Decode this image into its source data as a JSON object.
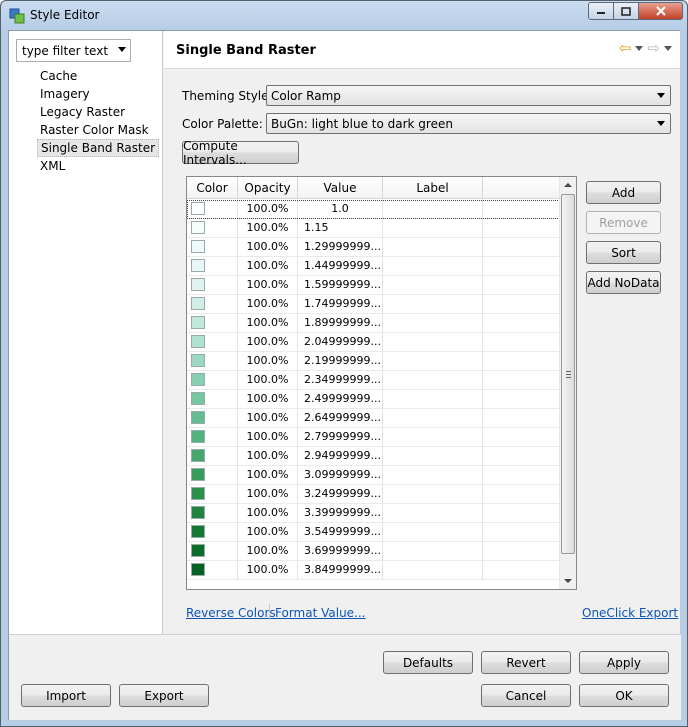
{
  "window": {
    "title": "Style Editor"
  },
  "filter": {
    "text": "type filter text he"
  },
  "tree": {
    "items": [
      "Cache",
      "Imagery",
      "Legacy Raster",
      "Raster Color Mask",
      "Single Band Raster",
      "XML"
    ],
    "selected": "Single Band Raster"
  },
  "page": {
    "title": "Single Band Raster"
  },
  "form": {
    "theming_label": "Theming Style:",
    "theming_value": "Color Ramp",
    "palette_label": "Color Palette:",
    "palette_value": "BuGn: light blue to dark green",
    "compute_label": "Compute Intervals..."
  },
  "table": {
    "headers": {
      "color": "Color",
      "opacity": "Opacity",
      "value": "Value",
      "label": "Label"
    },
    "rows": [
      {
        "color": "#ffffff",
        "opacity": "100.0%",
        "value": "1.0",
        "label": ""
      },
      {
        "color": "#f7fcfd",
        "opacity": "100.0%",
        "value": "1.15",
        "label": ""
      },
      {
        "color": "#f0f9fa",
        "opacity": "100.0%",
        "value": "1.29999999...",
        "label": ""
      },
      {
        "color": "#e8f6f7",
        "opacity": "100.0%",
        "value": "1.44999999...",
        "label": ""
      },
      {
        "color": "#e0f3f0",
        "opacity": "100.0%",
        "value": "1.59999999...",
        "label": ""
      },
      {
        "color": "#d2eee6",
        "opacity": "100.0%",
        "value": "1.74999999...",
        "label": ""
      },
      {
        "color": "#c2e8db",
        "opacity": "100.0%",
        "value": "1.89999999...",
        "label": ""
      },
      {
        "color": "#b0e1ce",
        "opacity": "100.0%",
        "value": "2.04999999...",
        "label": ""
      },
      {
        "color": "#9dd8c0",
        "opacity": "100.0%",
        "value": "2.19999999...",
        "label": ""
      },
      {
        "color": "#89cfb1",
        "opacity": "100.0%",
        "value": "2.34999999...",
        "label": ""
      },
      {
        "color": "#76c6a1",
        "opacity": "100.0%",
        "value": "2.49999999...",
        "label": ""
      },
      {
        "color": "#64bc91",
        "opacity": "100.0%",
        "value": "2.64999999...",
        "label": ""
      },
      {
        "color": "#54b27f",
        "opacity": "100.0%",
        "value": "2.79999999...",
        "label": ""
      },
      {
        "color": "#45a76d",
        "opacity": "100.0%",
        "value": "2.94999999...",
        "label": ""
      },
      {
        "color": "#389c5c",
        "opacity": "100.0%",
        "value": "3.09999999...",
        "label": ""
      },
      {
        "color": "#2b904c",
        "opacity": "100.0%",
        "value": "3.24999999...",
        "label": ""
      },
      {
        "color": "#1f843f",
        "opacity": "100.0%",
        "value": "3.39999999...",
        "label": ""
      },
      {
        "color": "#147833",
        "opacity": "100.0%",
        "value": "3.54999999...",
        "label": ""
      },
      {
        "color": "#0a6d29",
        "opacity": "100.0%",
        "value": "3.69999999...",
        "label": ""
      },
      {
        "color": "#036221",
        "opacity": "100.0%",
        "value": "3.84999999...",
        "label": ""
      }
    ]
  },
  "side_buttons": {
    "add": "Add",
    "remove": "Remove",
    "sort": "Sort",
    "add_nodata": "Add NoData"
  },
  "links": {
    "reverse": "Reverse Colors",
    "format": "Format Value...",
    "oneclick": "OneClick Export"
  },
  "bottom_buttons": {
    "defaults": "Defaults",
    "revert": "Revert",
    "apply": "Apply",
    "import": "Import",
    "export": "Export",
    "cancel": "Cancel",
    "ok": "OK"
  },
  "icons": {
    "app": "style-editor-icon",
    "back": "back-arrow-icon",
    "forward": "forward-arrow-icon"
  }
}
